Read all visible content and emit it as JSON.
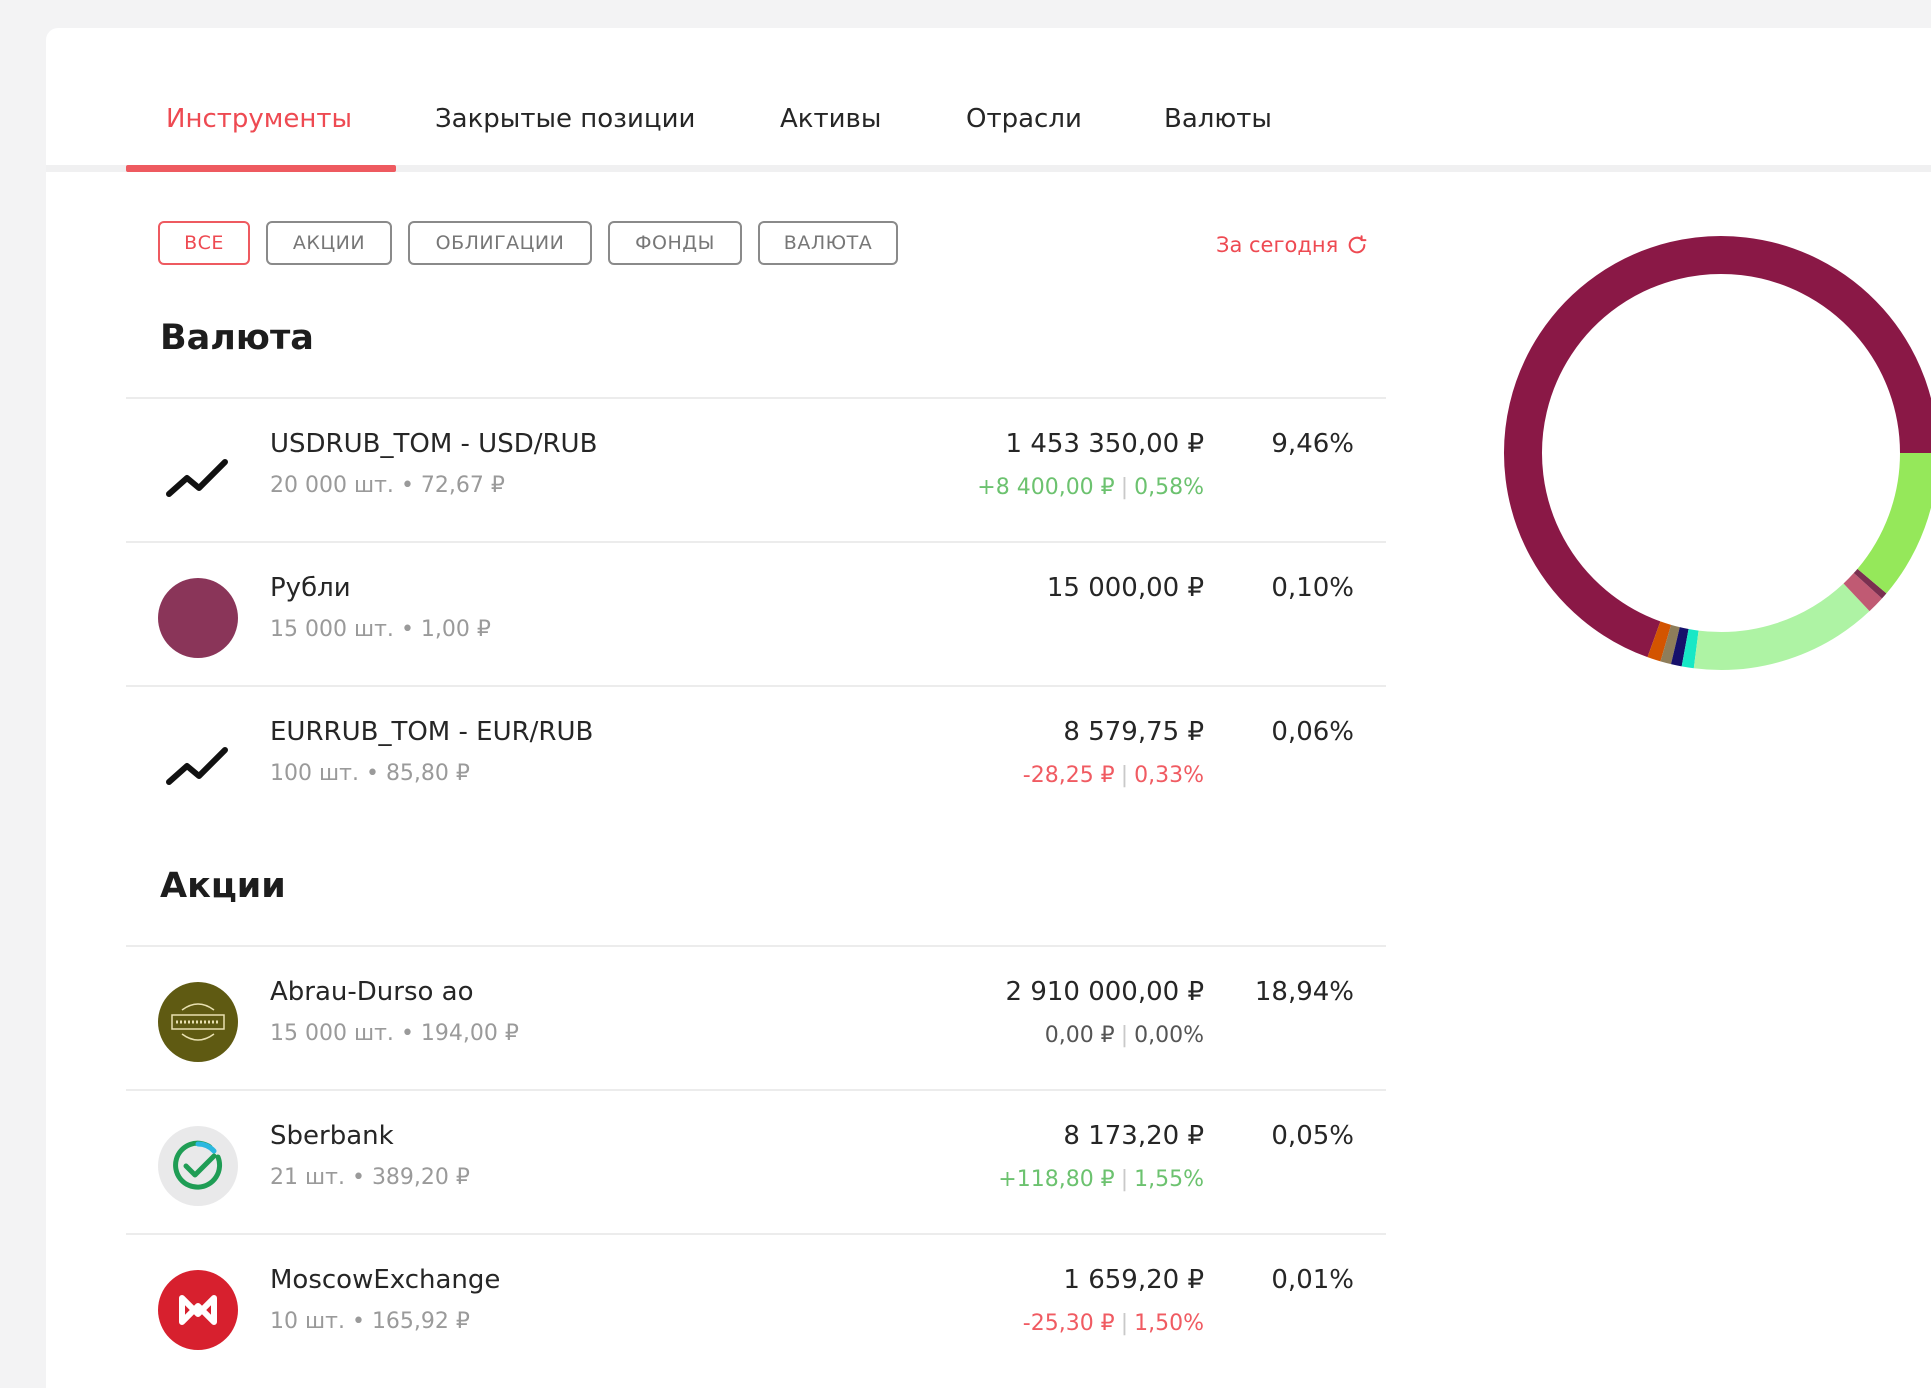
{
  "tabs": [
    {
      "label": "Инструменты",
      "active": true
    },
    {
      "label": "Закрытые позиции",
      "active": false
    },
    {
      "label": "Активы",
      "active": false
    },
    {
      "label": "Отрасли",
      "active": false
    },
    {
      "label": "Валюты",
      "active": false
    }
  ],
  "filters": [
    {
      "label": "ВСЕ",
      "active": true
    },
    {
      "label": "АКЦИИ",
      "active": false
    },
    {
      "label": "ОБЛИГАЦИИ",
      "active": false
    },
    {
      "label": "ФОНДЫ",
      "active": false
    },
    {
      "label": "ВАЛЮТА",
      "active": false
    }
  ],
  "period": {
    "label": "За сегодня",
    "icon": "refresh-icon"
  },
  "sections": [
    {
      "title": "Валюта",
      "rows": [
        {
          "name": "USDRUB_TOM - USD/RUB",
          "qty": "20 000",
          "unit": "шт.",
          "bullet": "•",
          "price": "72,67 ₽",
          "value": "1 453 350,00 ₽",
          "change_abs": "+8 400,00 ₽",
          "change_sep": "|",
          "change_pct": "0,58%",
          "trend": "pos",
          "share": "9,46%",
          "icon": "trend-icon"
        },
        {
          "name": "Рубли",
          "qty": "15 000",
          "unit": "шт.",
          "bullet": "•",
          "price": "1,00 ₽",
          "value": "15 000,00 ₽",
          "change_abs": "",
          "change_sep": "",
          "change_pct": "",
          "trend": "none",
          "share": "0,10%",
          "icon": "ruble-circle-icon"
        },
        {
          "name": "EURRUB_TOM - EUR/RUB",
          "qty": "100",
          "unit": "шт.",
          "bullet": "•",
          "price": "85,80 ₽",
          "value": "8 579,75 ₽",
          "change_abs": "-28,25 ₽",
          "change_sep": "|",
          "change_pct": "0,33%",
          "trend": "neg",
          "share": "0,06%",
          "icon": "trend-icon"
        }
      ]
    },
    {
      "title": "Акции",
      "rows": [
        {
          "name": "Abrau-Durso ao",
          "qty": "15 000",
          "unit": "шт.",
          "bullet": "•",
          "price": "194,00 ₽",
          "value": "2 910 000,00 ₽",
          "change_abs": "0,00 ₽",
          "change_sep": "|",
          "change_pct": "0,00%",
          "trend": "neu",
          "share": "18,94%",
          "icon": "abrau-durso-logo-icon"
        },
        {
          "name": "Sberbank",
          "qty": "21",
          "unit": "шт.",
          "bullet": "•",
          "price": "389,20 ₽",
          "value": "8 173,20 ₽",
          "change_abs": "+118,80 ₽",
          "change_sep": "|",
          "change_pct": "1,55%",
          "trend": "pos",
          "share": "0,05%",
          "icon": "sberbank-logo-icon"
        },
        {
          "name": "MoscowExchange",
          "qty": "10",
          "unit": "шт.",
          "bullet": "•",
          "price": "165,92 ₽",
          "value": "1 659,20 ₽",
          "change_abs": "-25,30 ₽",
          "change_sep": "|",
          "change_pct": "1,50%",
          "trend": "neg",
          "share": "0,01%",
          "icon": "moex-logo-icon"
        }
      ]
    }
  ],
  "colors": {
    "accent": "#ee4a52",
    "positive": "#6cc26f",
    "negative": "#f05b62"
  },
  "donut": {
    "segments": [
      {
        "value": 69.5,
        "color": "#8a1846"
      },
      {
        "value": 1.0,
        "color": "#d35400"
      },
      {
        "value": 0.8,
        "color": "#8e7d5a"
      },
      {
        "value": 0.8,
        "color": "#16106b"
      },
      {
        "value": 0.9,
        "color": "#17e8c6"
      },
      {
        "value": 14.0,
        "color": "#aef3a4"
      },
      {
        "value": 1.3,
        "color": "#c05a73"
      },
      {
        "value": 0.5,
        "color": "#7a3050"
      },
      {
        "value": 11.2,
        "color": "#95e85a"
      }
    ]
  }
}
